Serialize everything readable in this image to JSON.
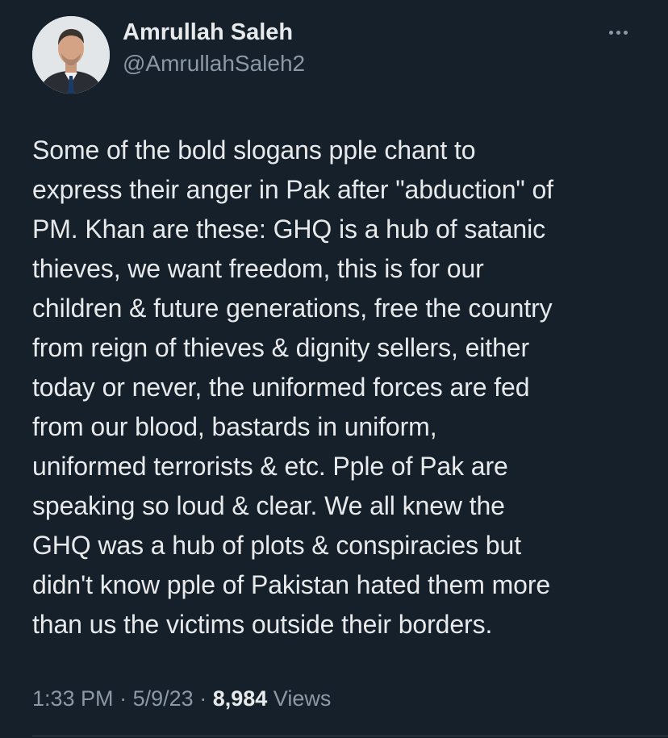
{
  "author": {
    "display_name": "Amrullah Saleh",
    "handle": "@AmrullahSaleh2",
    "avatar_icon": "profile-photo-icon"
  },
  "more_icon": "more-horizontal-icon",
  "tweet": {
    "text": "Some of the bold slogans pple chant  to\nexpress their anger in Pak after \"abduction\" of\nPM. Khan are these: GHQ is a hub of satanic\nthieves, we want freedom, this is for our\nchildren & future generations, free the country\nfrom reign of thieves & dignity sellers, either\ntoday or never, the uniformed forces are fed\nfrom our blood, bastards in uniform,\nuniformed terrorists & etc.  Pple of Pak are\nspeaking  so loud & clear.  We all knew the\nGHQ was a hub of plots & conspiracies but\ndidn't know pple of Pakistan hated them more\nthan us the victims outside their borders."
  },
  "meta": {
    "time": "1:33 PM",
    "separator": "·",
    "date": "5/9/23",
    "views_count": "8,984",
    "views_label": "Views"
  },
  "colors": {
    "background": "#15202b",
    "primary_text": "#e7e9ea",
    "secondary_text": "#8b98a5",
    "divider": "#38444d"
  }
}
